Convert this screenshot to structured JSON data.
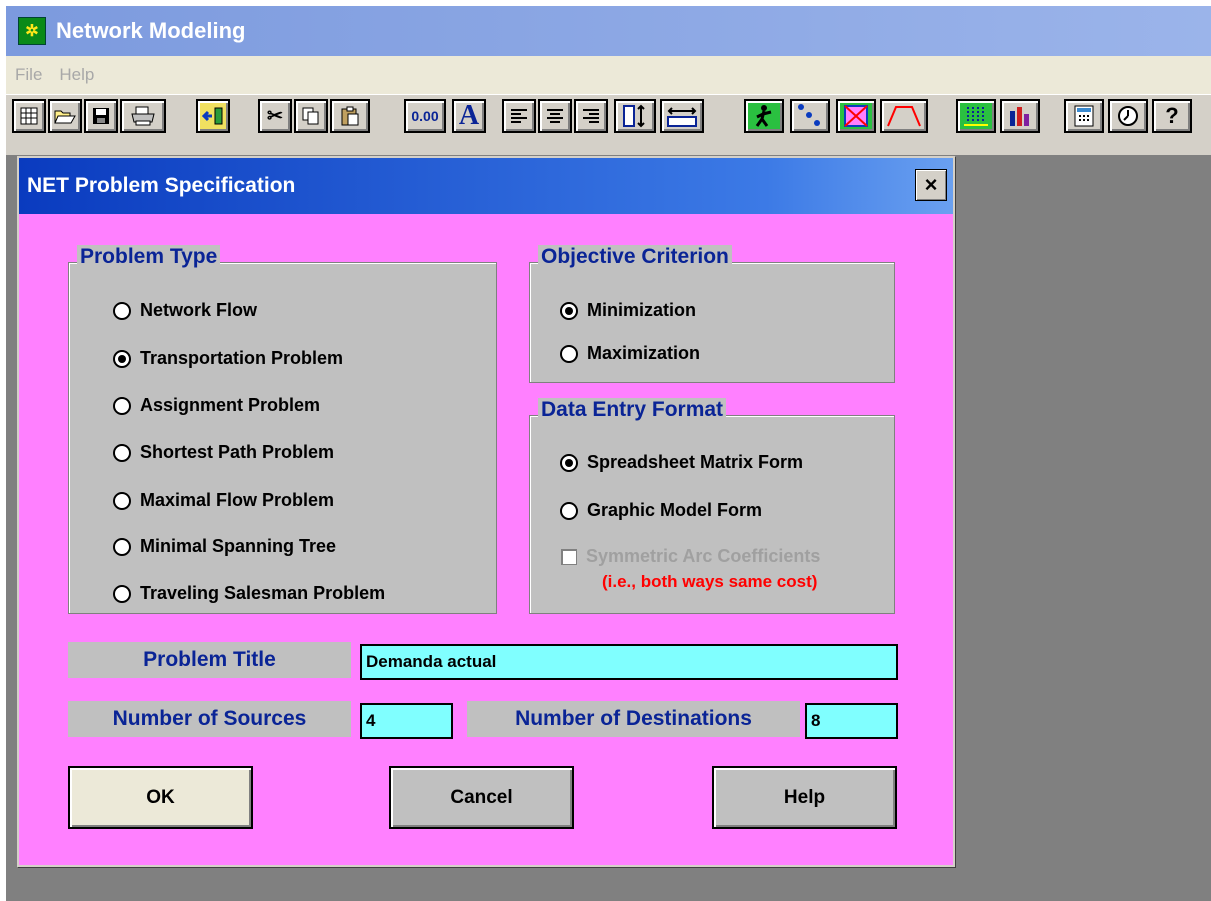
{
  "app": {
    "title": "Network Modeling"
  },
  "menu": [
    "File",
    "Help"
  ],
  "toolbar": {
    "buttons": [
      "new-icon",
      "open-icon",
      "save-icon",
      "print-icon",
      "exit-icon",
      "cut-icon",
      "copy-icon",
      "paste-icon",
      "number-format-icon",
      "font-icon",
      "align-left-icon",
      "align-center-icon",
      "align-right-icon",
      "row-height-icon",
      "column-width-icon",
      "solve-icon",
      "graph-nodes-icon",
      "switch-view-icon",
      "graph-flow-icon",
      "chart-icon",
      "bar-chart-icon",
      "calculator-icon",
      "clock-icon",
      "help-icon"
    ],
    "number_format_label": "0.00",
    "font_label": "A",
    "help_label": "?"
  },
  "dialog": {
    "title": "NET Problem Specification",
    "close_label": "×",
    "problem_type": {
      "title": "Problem Type",
      "options": [
        "Network Flow",
        "Transportation Problem",
        "Assignment Problem",
        "Shortest Path Problem",
        "Maximal Flow Problem",
        "Minimal Spanning Tree",
        "Traveling Salesman Problem"
      ],
      "selected": "Transportation Problem"
    },
    "objective": {
      "title": "Objective Criterion",
      "options": [
        "Minimization",
        "Maximization"
      ],
      "selected": "Minimization"
    },
    "data_entry": {
      "title": "Data Entry Format",
      "options": [
        "Spreadsheet Matrix Form",
        "Graphic Model Form"
      ],
      "selected": "Spreadsheet Matrix Form",
      "symmetric_label": "Symmetric Arc Coefficients",
      "symmetric_note": "(i.e., both ways same cost)",
      "symmetric_checked": false
    },
    "problem_title": {
      "label": "Problem Title",
      "value": "Demanda actual"
    },
    "sources": {
      "label": "Number of Sources",
      "value": "4"
    },
    "destinations": {
      "label": "Number of Destinations",
      "value": "8"
    },
    "buttons": {
      "ok": "OK",
      "cancel": "Cancel",
      "help": "Help"
    }
  },
  "colors": {
    "dialog_bg": "#ff80ff",
    "title_gradient_start": "#0a3bbf",
    "group_title": "#0a2496",
    "input_bg": "#80ffff",
    "note_red": "#ff0000",
    "disabled_text": "#a0a0a0"
  }
}
